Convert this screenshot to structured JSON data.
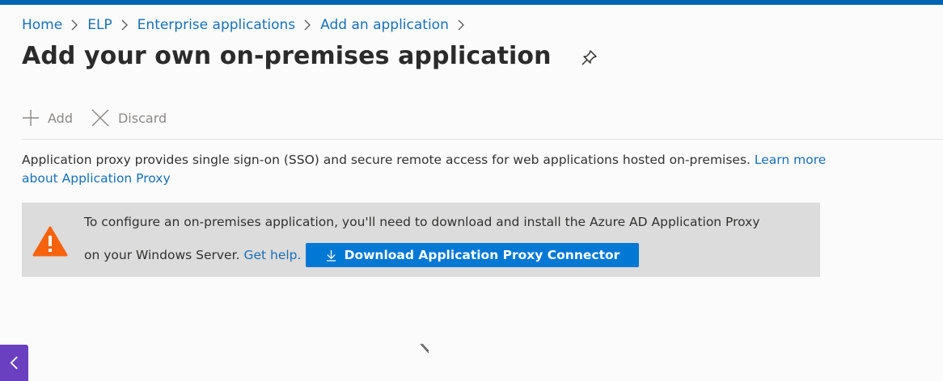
{
  "breadcrumb": [
    {
      "label": "Home"
    },
    {
      "label": "ELP"
    },
    {
      "label": "Enterprise applications"
    },
    {
      "label": "Add an application"
    }
  ],
  "header": {
    "title": "Add your own on-premises application",
    "pin_icon": "pin-icon"
  },
  "toolbar": {
    "add_label": "Add",
    "discard_label": "Discard"
  },
  "description": {
    "text": "Application proxy provides single sign-on (SSO) and secure remote access for web applications hosted on-premises.",
    "link": "Learn more about Application Proxy"
  },
  "banner": {
    "line1": "To configure an on-premises application, you'll need to download and install the Azure AD Application Proxy",
    "line2": "on your Windows Server.",
    "help_link": "Get help.",
    "download_button": "Download Application Proxy Connector",
    "icon": "warning-icon"
  },
  "colors": {
    "accent": "#0078d4",
    "link": "#1a6fb5",
    "warning": "#f7630c",
    "banner_bg": "#dcdcdc",
    "back_button": "#6a3fc0"
  }
}
